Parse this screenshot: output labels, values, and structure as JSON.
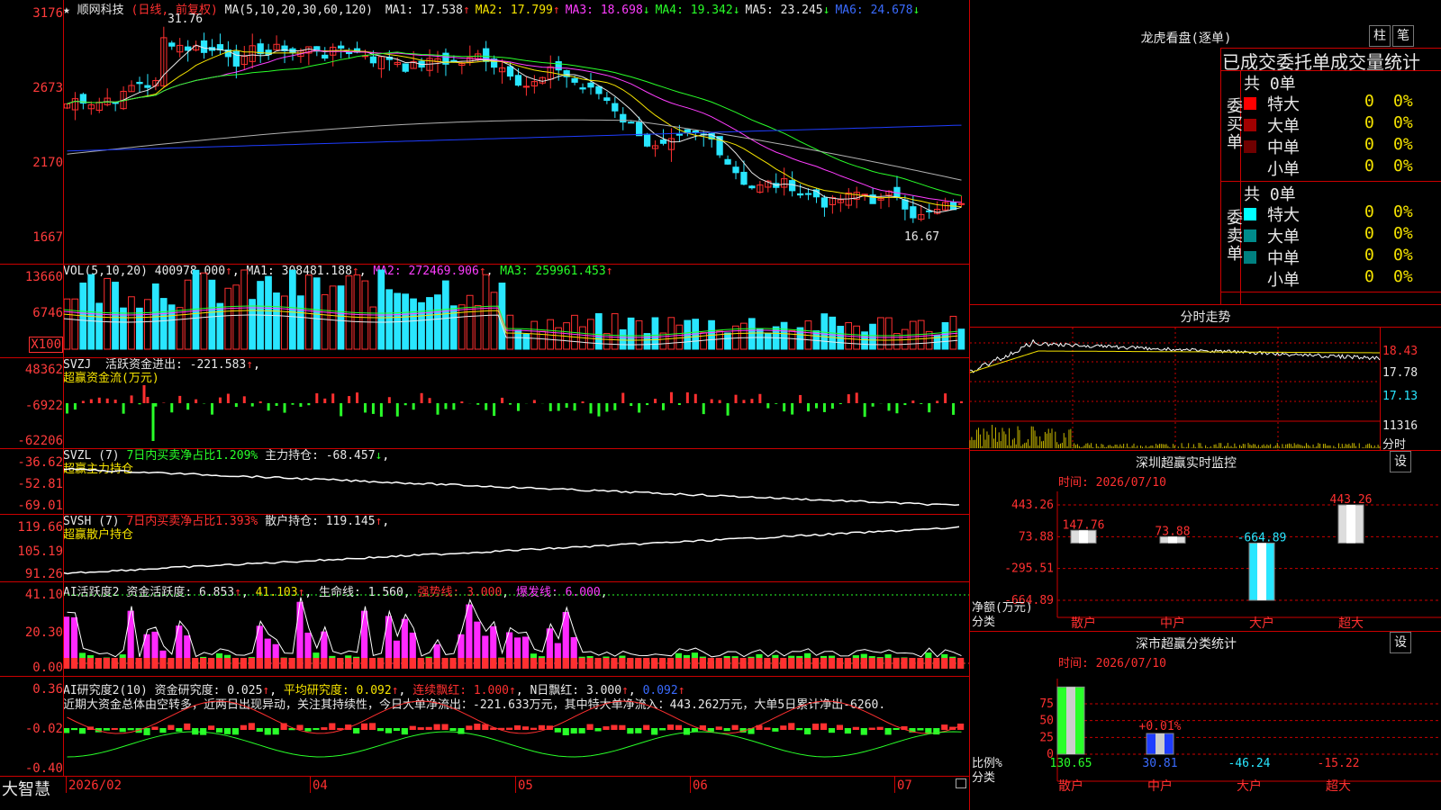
{
  "main_chart": {
    "star": "★",
    "stock_name": "顺网科技",
    "period": "(日线, 前复权)",
    "ma_indicator": "MA(5,10,20,30,60,120)",
    "ma_values": [
      {
        "label": "MA1:",
        "value": "17.538",
        "arrow": "↑",
        "color": "#e8e8e8"
      },
      {
        "label": "MA2:",
        "value": "17.799",
        "arrow": "↑",
        "color": "#f6e400"
      },
      {
        "label": "MA3:",
        "value": "18.698",
        "arrow": "↓",
        "color": "#ff3dff"
      },
      {
        "label": "MA4:",
        "value": "19.342",
        "arrow": "↓",
        "color": "#29ff29"
      },
      {
        "label": "MA5:",
        "value": "23.245",
        "arrow": "↓",
        "color": "#e8e8e8"
      },
      {
        "label": "MA6:",
        "value": "24.678",
        "arrow": "↓",
        "color": "#3a6bff"
      }
    ],
    "y_ticks": [
      "3176",
      "2673",
      "2170",
      "1667"
    ],
    "high_label": "31.76",
    "low_label": "16.67",
    "ma_colors": {
      "ma5": "#e8e8e8",
      "ma10": "#f6e400",
      "ma20": "#ff3dff",
      "ma30": "#29ff29",
      "ma60": "#b0b0b0",
      "ma120": "#1f3dff"
    }
  },
  "volume": {
    "header": "VOL(5,10,20)",
    "value": "400978.000",
    "ma1": "MA1: 308481.188",
    "ma2": "MA2: 272469.906",
    "ma3": "MA3: 259961.453",
    "y_ticks": [
      "13660",
      "6746"
    ],
    "unit": "X100"
  },
  "svzj": {
    "header": "SVZJ",
    "label": "活跃资金进出: -221.583",
    "arrow": "↑",
    "subtitle": "超赢资金流(万元)",
    "y_ticks": [
      "48362",
      "-6922",
      "-62206"
    ]
  },
  "svzl": {
    "header": "SVZL (7)",
    "ratio": "7日内买卖净占比1.209%",
    "holding": "主力持仓: -68.457",
    "arrow": "↓",
    "subtitle": "超赢主力持仓",
    "y_ticks": [
      "-36.62",
      "-52.81",
      "-69.01"
    ]
  },
  "svsh": {
    "header": "SVSH (7)",
    "ratio": "7日内买卖净占比1.393%",
    "holding": "散户持仓: 119.145",
    "arrow": "↑",
    "subtitle": "超赢散户持仓",
    "y_ticks": [
      "119.66",
      "105.19",
      "91.26"
    ]
  },
  "ai_active": {
    "header": "AI活跃度2",
    "activity": "资金活跃度: 6.853",
    "v2": "41.103",
    "life": "生命线: 1.560",
    "strong": "强势线: 3.000",
    "burst": "爆发线: 6.000",
    "y_ticks": [
      "41.10",
      "20.30",
      "0.00"
    ]
  },
  "ai_research": {
    "header": "AI研究度2(10)",
    "research": "资金研究度: 0.025",
    "avg": "平均研究度: 0.092",
    "streak": "连续飘红: 1.000",
    "nday": "N日飘红: 3.000",
    "last": "0.092",
    "commentary": "近期大资金总体由空转多，近两日出现异动，关注其持续性，今日大单净流出：-221.633万元，其中特大单净流入：443.262万元，大单5日累计净出-6260.",
    "y_ticks": [
      "0.36",
      "-0.02",
      "-0.40"
    ]
  },
  "bottom_axis": {
    "brand": "大智慧",
    "labels": [
      "2026/02",
      "04",
      "05",
      "06",
      "07"
    ]
  },
  "dragon_tiger": {
    "title": "龙虎看盘(逐单)",
    "btn_bar": "柱",
    "btn_pen": "笔",
    "subtitle": "已成交委托单成交量统计",
    "buy_label": "委买单",
    "sell_label": "委卖单",
    "buy_total": "共 0单",
    "sell_total": "共 0单",
    "buy_rows": [
      {
        "name": "特大",
        "count": "0",
        "pct": "0%",
        "color": "#ff0000"
      },
      {
        "name": "大单",
        "count": "0",
        "pct": "0%",
        "color": "#a00000"
      },
      {
        "name": "中单",
        "count": "0",
        "pct": "0%",
        "color": "#700000"
      },
      {
        "name": "小单",
        "count": "0",
        "pct": "0%",
        "color": ""
      }
    ],
    "sell_rows": [
      {
        "name": "特大",
        "count": "0",
        "pct": "0%",
        "color": "#00ffff"
      },
      {
        "name": "大单",
        "count": "0",
        "pct": "0%",
        "color": "#008b8b"
      },
      {
        "name": "中单",
        "count": "0",
        "pct": "0%",
        "color": "#008080"
      },
      {
        "name": "小单",
        "count": "0",
        "pct": "0%",
        "color": ""
      }
    ]
  },
  "intraday": {
    "title": "分时走势",
    "y_ticks": [
      "18.43",
      "17.78",
      "17.13"
    ],
    "vol_label": "11316",
    "time_label": "分时"
  },
  "sz_monitor": {
    "title": "深圳超赢实时监控",
    "btn": "设",
    "time": "时间: 2026/07/10",
    "y_ticks": [
      "443.26",
      "73.88",
      "-295.51",
      "-664.89"
    ],
    "y_label": "净额(万元)",
    "x_label": "分类",
    "categories": [
      "散户",
      "中户",
      "大户",
      "超大"
    ],
    "values": [
      147.76,
      73.88,
      -664.89,
      443.26
    ],
    "value_labels": [
      "147.76",
      "73.88",
      "-664.89",
      "443.26"
    ]
  },
  "sz_classify": {
    "title": "深市超赢分类统计",
    "btn": "设",
    "time": "时间: 2026/07/10",
    "y_ticks": [
      "75",
      "50",
      "25",
      "0"
    ],
    "y_label": "比例%",
    "x_label": "分类",
    "categories": [
      "散户",
      "中户",
      "大户",
      "超大"
    ],
    "values": [
      130.65,
      30.81,
      -46.24,
      -15.22
    ],
    "value_labels": [
      "130.65",
      "30.81",
      "-46.24",
      "-15.22"
    ],
    "extra_label": "+0.01%"
  },
  "colors": {
    "up": "#ff3030",
    "down": "#29e6ff",
    "grid": "#c00000"
  }
}
